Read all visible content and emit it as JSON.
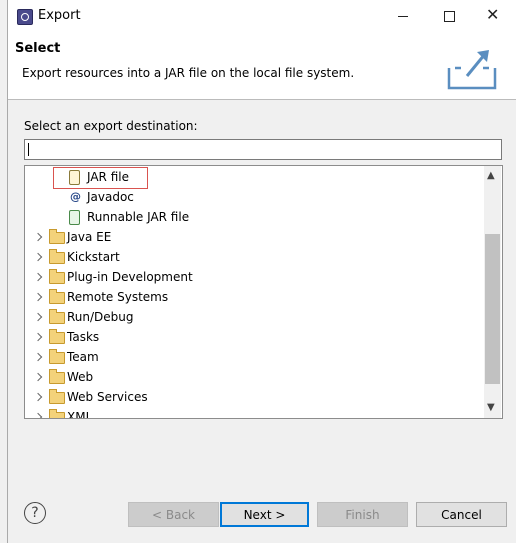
{
  "window": {
    "title": "Export",
    "controls": {
      "minimize": "minimize",
      "maximize": "maximize",
      "close": "✕"
    }
  },
  "header": {
    "title": "Select",
    "description": "Export resources into a JAR file on the local file system."
  },
  "prompt_label": "Select an export destination:",
  "filter": {
    "value": ""
  },
  "tree": {
    "selected_index": 0,
    "items": [
      {
        "label": "JAR file",
        "icon": "jar-file-icon",
        "expandable": false,
        "indent": 1
      },
      {
        "label": "Javadoc",
        "icon": "javadoc-icon",
        "expandable": false,
        "indent": 1
      },
      {
        "label": "Runnable JAR file",
        "icon": "runnable-jar-icon",
        "expandable": false,
        "indent": 1
      },
      {
        "label": "Java EE",
        "icon": "folder-icon",
        "expandable": true,
        "indent": 0
      },
      {
        "label": "Kickstart",
        "icon": "folder-icon",
        "expandable": true,
        "indent": 0
      },
      {
        "label": "Plug-in Development",
        "icon": "folder-icon",
        "expandable": true,
        "indent": 0
      },
      {
        "label": "Remote Systems",
        "icon": "folder-icon",
        "expandable": true,
        "indent": 0
      },
      {
        "label": "Run/Debug",
        "icon": "folder-icon",
        "expandable": true,
        "indent": 0
      },
      {
        "label": "Tasks",
        "icon": "folder-icon",
        "expandable": true,
        "indent": 0
      },
      {
        "label": "Team",
        "icon": "folder-icon",
        "expandable": true,
        "indent": 0
      },
      {
        "label": "Web",
        "icon": "folder-icon",
        "expandable": true,
        "indent": 0
      },
      {
        "label": "Web Services",
        "icon": "folder-icon",
        "expandable": true,
        "indent": 0
      },
      {
        "label": "XML",
        "icon": "folder-icon",
        "expandable": true,
        "indent": 0
      }
    ]
  },
  "buttons": {
    "help": "?",
    "back": "< Back",
    "next": "Next >",
    "finish": "Finish",
    "cancel": "Cancel"
  },
  "colors": {
    "highlight": "#d9534f",
    "default_button": "#0078d7"
  }
}
